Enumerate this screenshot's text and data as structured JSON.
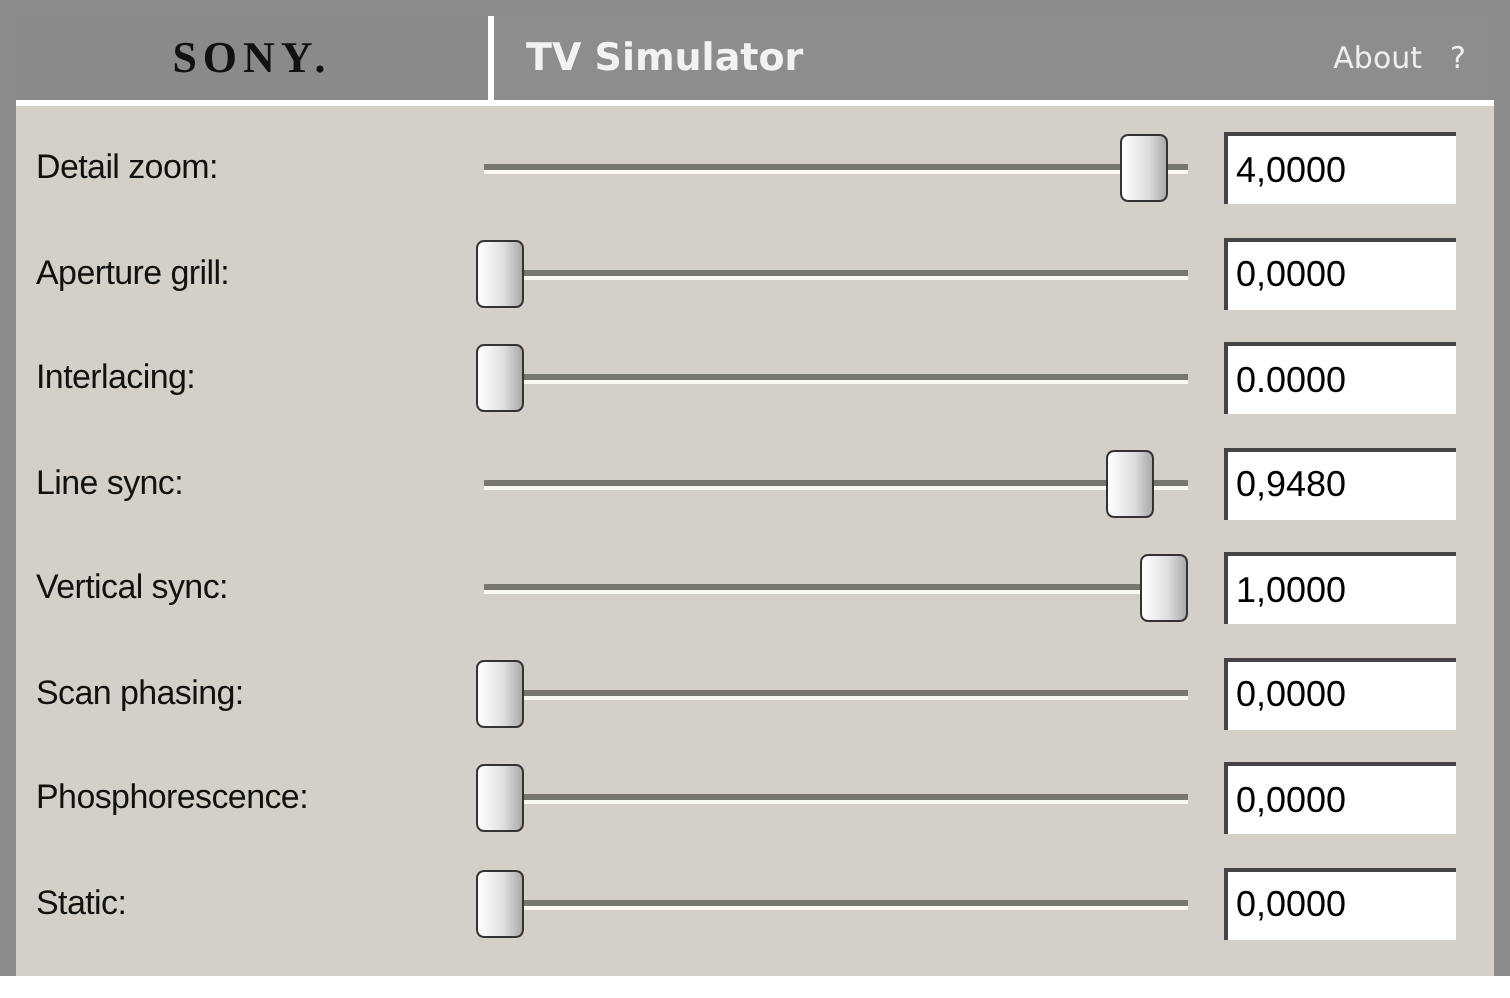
{
  "header": {
    "logo": "SONY.",
    "title": "TV Simulator",
    "about": "About",
    "help": "?"
  },
  "settings": [
    {
      "label": "Detail zoom:",
      "level": 0.97,
      "value": "4,0000"
    },
    {
      "label": "Aperture grill:",
      "level": 0,
      "value": "0,0000"
    },
    {
      "label": "Interlacing:",
      "level": 0,
      "value": "0.0000"
    },
    {
      "label": "Line sync:",
      "level": 0.948,
      "value": "0,9480"
    },
    {
      "label": "Vertical sync:",
      "level": 1,
      "value": "1,0000"
    },
    {
      "label": "Scan phasing:",
      "level": 0,
      "value": "0,0000"
    },
    {
      "label": "Phosphorescence:",
      "level": 0,
      "value": "0,0000"
    },
    {
      "label": "Static:",
      "level": 0,
      "value": "0,0000"
    }
  ]
}
